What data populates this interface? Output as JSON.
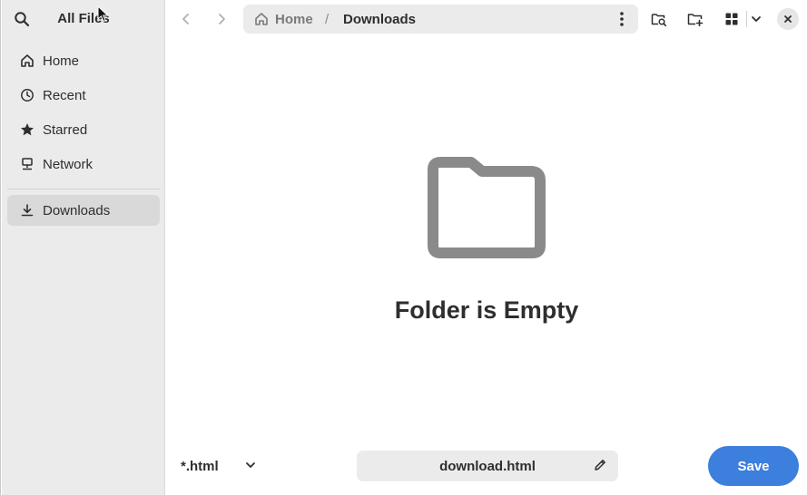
{
  "sidebar": {
    "title": "All Files",
    "search_icon": "search-icon",
    "items": [
      {
        "label": "Home",
        "icon": "home-icon"
      },
      {
        "label": "Recent",
        "icon": "clock-icon"
      },
      {
        "label": "Starred",
        "icon": "star-icon"
      },
      {
        "label": "Network",
        "icon": "network-icon"
      },
      {
        "label": "Downloads",
        "icon": "download-icon",
        "active": true
      }
    ]
  },
  "header": {
    "back_icon": "chevron-left-icon",
    "forward_icon": "chevron-right-icon",
    "path": {
      "home_label": "Home",
      "separator": "/",
      "current_label": "Downloads"
    },
    "actions": [
      "folder-search-icon",
      "new-folder-icon",
      "grid-view-icon",
      "chevron-down-icon",
      "close-icon"
    ]
  },
  "content": {
    "empty_title": "Folder is Empty",
    "empty_icon": "folder-icon"
  },
  "footer": {
    "filter_value": "*.html",
    "filename_value": "download.html",
    "save_label": "Save"
  },
  "colors": {
    "accent": "#3c7fdc",
    "sidebar_bg": "#ebebeb",
    "active_item_bg": "#d9d9d9",
    "empty_icon": "#8a8a8a"
  }
}
